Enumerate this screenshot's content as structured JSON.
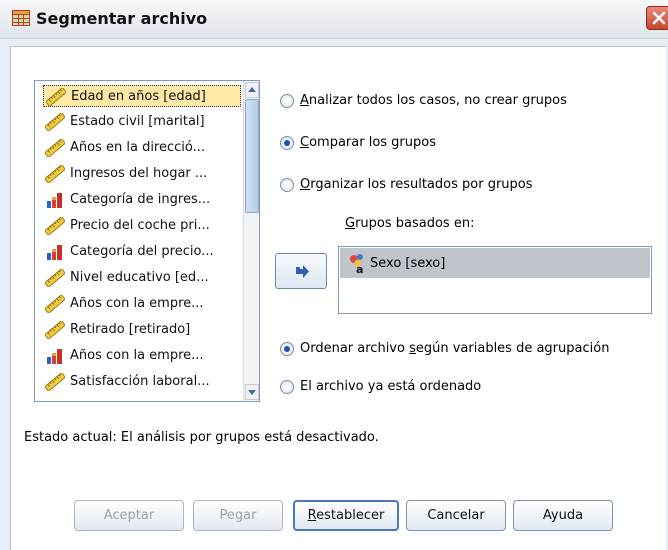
{
  "window": {
    "title": "Segmentar archivo",
    "close_icon": "close-icon"
  },
  "variables": {
    "items": [
      {
        "label": "Edad en años [edad]",
        "icon": "scale-ruler-icon",
        "selected": true
      },
      {
        "label": "Estado civil [marital]",
        "icon": "scale-ruler-icon"
      },
      {
        "label": "Años en la direcció...",
        "icon": "scale-ruler-icon"
      },
      {
        "label": "Ingresos del hogar ...",
        "icon": "scale-ruler-icon"
      },
      {
        "label": "Categoría de ingres...",
        "icon": "ordinal-bars-icon"
      },
      {
        "label": "Precio del coche pri...",
        "icon": "scale-ruler-icon"
      },
      {
        "label": "Categoría del precio...",
        "icon": "ordinal-bars-icon"
      },
      {
        "label": "Nivel educativo [ed...",
        "icon": "scale-ruler-icon"
      },
      {
        "label": "Años con la empre...",
        "icon": "scale-ruler-icon"
      },
      {
        "label": "Retirado [retirado]",
        "icon": "scale-ruler-icon"
      },
      {
        "label": "Años con la empre...",
        "icon": "ordinal-bars-icon"
      },
      {
        "label": "Satisfacción laboral...",
        "icon": "scale-ruler-icon"
      }
    ]
  },
  "options": {
    "analyze_all": {
      "mnemonic": "A",
      "rest": "nalizar todos los casos, no crear grupos",
      "checked": false
    },
    "compare": {
      "mnemonic": "C",
      "rest": "omparar los grupos",
      "checked": true
    },
    "organize": {
      "mnemonic": "O",
      "rest": "rganizar los resultados por grupos",
      "checked": false
    }
  },
  "groups": {
    "label_mnemonic": "G",
    "label_rest": "rupos basados en:",
    "items": [
      {
        "label": "Sexo [sexo]",
        "icon": "nominal-variable-icon"
      }
    ]
  },
  "sort": {
    "sort_by_vars": {
      "before": "Ordenar archivo ",
      "mnemonic": "s",
      "after": "egún variables de agrupación",
      "checked": true
    },
    "already_sorted": {
      "label": "El archivo ya está ordenado",
      "checked": false
    }
  },
  "status": "Estado actual: El análisis por grupos está desactivado.",
  "buttons": {
    "ok": "Aceptar",
    "paste": "Pegar",
    "reset_mnemonic": "R",
    "reset_rest": "establecer",
    "cancel": "Cancelar",
    "help": "Ayuda"
  },
  "colors": {
    "selected_item_bg": "#ffe9a6",
    "group_item_bg": "#c0c4cb",
    "radio_dot": "#1a4fb8"
  }
}
